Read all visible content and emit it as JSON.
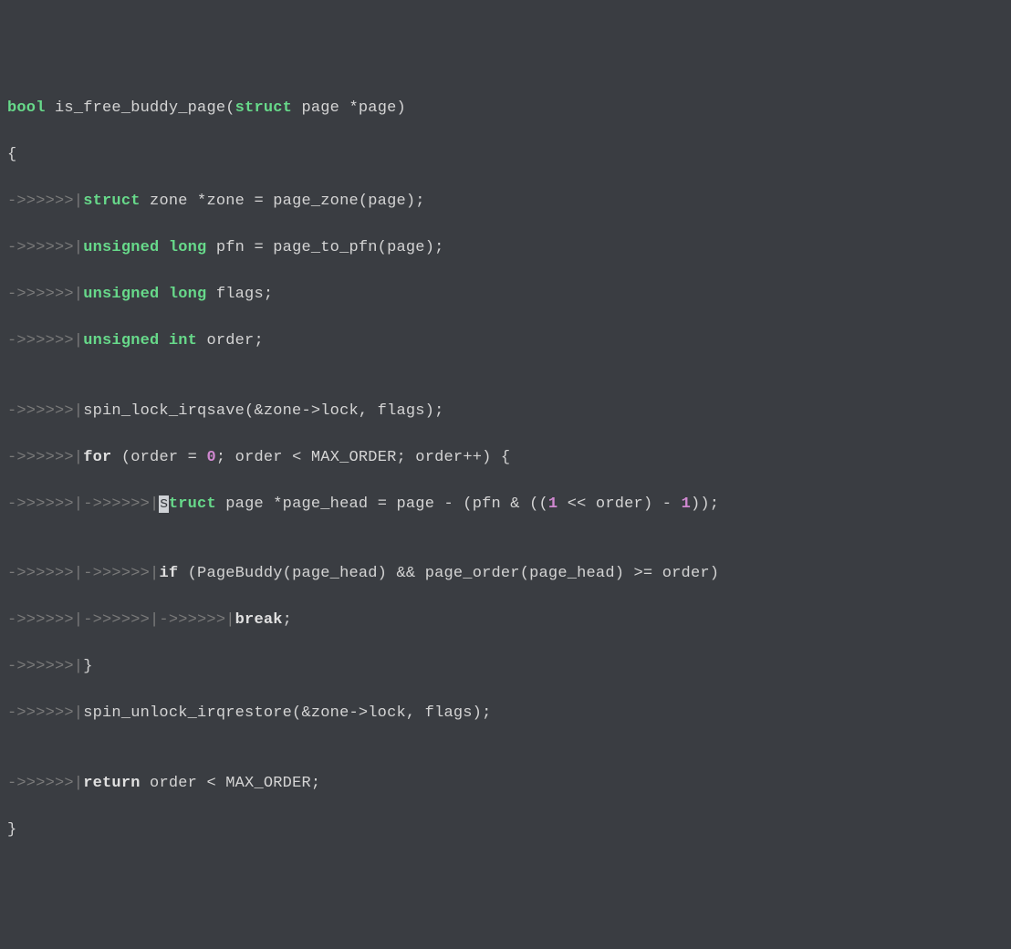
{
  "ws": {
    "indent1": "->>>>>>|",
    "indent2": "->>>>>>|->>>>>>|",
    "indent3": "->>>>>>|->>>>>>|->>>>>>|"
  },
  "code": {
    "l1_bool": "bool",
    "l1_rest": " is_free_buddy_page(",
    "l1_struct": "struct",
    "l1_rest2": " page *page)",
    "l2": "{",
    "l3_struct": "struct",
    "l3_rest": " zone *zone = page_zone(page);",
    "l4_unsigned": "unsigned",
    "l4_long": " long",
    "l4_rest": " pfn = page_to_pfn(page);",
    "l5_unsigned": "unsigned",
    "l5_long": " long",
    "l5_rest": " flags;",
    "l6_unsigned": "unsigned",
    "l6_int": " int",
    "l6_rest": " order;",
    "l7_blank": "",
    "l8": "spin_lock_irqsave(&zone->lock, flags);",
    "l9_for": "for",
    "l9_rest1": " (order = ",
    "l9_zero": "0",
    "l9_rest2": "; order < MAX_ORDER; order++) {",
    "l10_cursor": "s",
    "l10_struct_rest": "truct",
    "l10_rest1": " page *page_head = page - (pfn & ((",
    "l10_one": "1",
    "l10_rest2": " << order) - ",
    "l10_one2": "1",
    "l10_rest3": "));",
    "l11_blank": "",
    "l12_if": "if",
    "l12_rest": " (PageBuddy(page_head) && page_order(page_head) >= order)",
    "l13_break": "break",
    "l13_semi": ";",
    "l14": "}",
    "l15": "spin_unlock_irqrestore(&zone->lock, flags);",
    "l16_blank": "",
    "l17_return": "return",
    "l17_rest": " order < MAX_ORDER;",
    "l18": "}"
  }
}
